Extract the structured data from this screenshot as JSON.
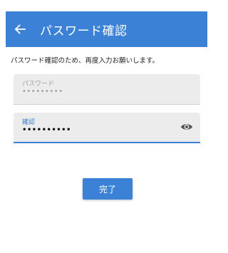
{
  "appbar": {
    "title": "パスワード確認",
    "back_icon": "arrow-left-icon",
    "background_color": "#3b82d6"
  },
  "instruction": "パスワード確認のため、再度入力お願いします。",
  "password_field": {
    "label": "パスワード",
    "value": "•••••••••",
    "state": "disabled"
  },
  "confirm_field": {
    "label": "確認",
    "value": "••••••••••",
    "state": "focused",
    "toggle_icon": "eye-icon"
  },
  "done_button": {
    "label": "完了"
  }
}
